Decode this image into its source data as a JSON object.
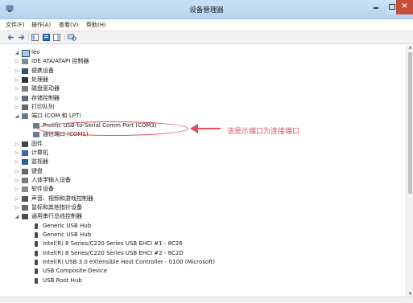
{
  "window": {
    "title": "设备管理器"
  },
  "menu": {
    "items": [
      "文件(F)",
      "操作(A)",
      "查看(V)",
      "帮助(H)"
    ]
  },
  "tree": {
    "root_label": "leo",
    "nodes": [
      {
        "label": "IDE ATA/ATAPI 控制器",
        "icon": "ide-controller-icon"
      },
      {
        "label": "便携设备",
        "icon": "portable-device-icon"
      },
      {
        "label": "处理器",
        "icon": "processor-icon"
      },
      {
        "label": "磁盘驱动器",
        "icon": "disk-drive-icon"
      },
      {
        "label": "存储控制器",
        "icon": "storage-controller-icon"
      },
      {
        "label": "打印队列",
        "icon": "printer-icon"
      },
      {
        "label": "端口 (COM 和 LPT)",
        "icon": "port-icon"
      },
      {
        "label": "Prolific USB-to-Serial Comm Port (COM3)",
        "icon": "port-icon"
      },
      {
        "label": "通信端口 (COM1)",
        "icon": "port-icon"
      },
      {
        "label": "固件",
        "icon": "firmware-icon"
      },
      {
        "label": "计算机",
        "icon": "computer-icon"
      },
      {
        "label": "监视器",
        "icon": "monitor-icon"
      },
      {
        "label": "键盘",
        "icon": "keyboard-icon"
      },
      {
        "label": "人体学输入设备",
        "icon": "hid-icon"
      },
      {
        "label": "软件设备",
        "icon": "software-device-icon"
      },
      {
        "label": "声音、视频和游戏控制器",
        "icon": "sound-icon"
      },
      {
        "label": "鼠标和其他指针设备",
        "icon": "mouse-icon"
      },
      {
        "label": "通用串行总线控制器",
        "icon": "usb-icon"
      },
      {
        "label": "Generic USB Hub",
        "icon": "usb-icon"
      },
      {
        "label": "Generic USB Hub",
        "icon": "usb-icon"
      },
      {
        "label": "Intel(R) 8 Series/C220 Series USB EHCI #1 - 8C26",
        "icon": "usb-icon"
      },
      {
        "label": "Intel(R) 8 Series/C220 Series USB EHCI #2 - 8C2D",
        "icon": "usb-icon"
      },
      {
        "label": "Intel(R) USB 3.0 eXtensible Host Controller - 0100 (Microsoft)",
        "icon": "usb-icon"
      },
      {
        "label": "USB Composite Device",
        "icon": "usb-icon"
      },
      {
        "label": "USB Root Hub",
        "icon": "usb-icon"
      }
    ]
  },
  "annotation": {
    "note": "该是示端口为连接端口",
    "color": "#e0525a"
  }
}
